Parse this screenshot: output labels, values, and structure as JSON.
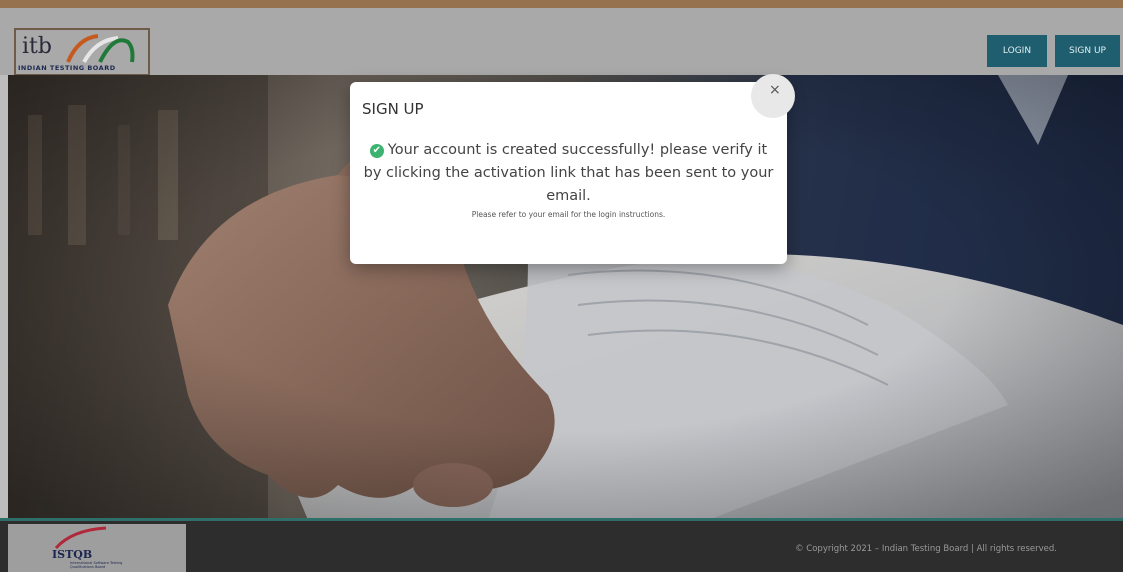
{
  "header": {
    "logo_text": "itb",
    "logo_subtitle": "INDIAN TESTING BOARD",
    "login_label": "LOGIN",
    "signup_label": "SIGN UP"
  },
  "modal": {
    "title": "SIGN UP",
    "close_label": "×",
    "message": "Your account is created successfully! please verify it by clicking the activation link that has been sent to your email.",
    "note": "Please refer to your email for the login instructions."
  },
  "footer": {
    "istqb_logo_text": "ISTQB",
    "istqb_logo_subtitle": "International Software Testing Qualifications Board",
    "copyright": "© Copyright 2021 – Indian Testing Board | All rights reserved."
  },
  "icons": {
    "success": "check-circle-icon",
    "close": "close-icon"
  },
  "colors": {
    "button_bg": "#1e5e6e",
    "success": "#3cb371",
    "footer_accent": "#2f6f6a",
    "top_accent": "#8a5a2b"
  }
}
